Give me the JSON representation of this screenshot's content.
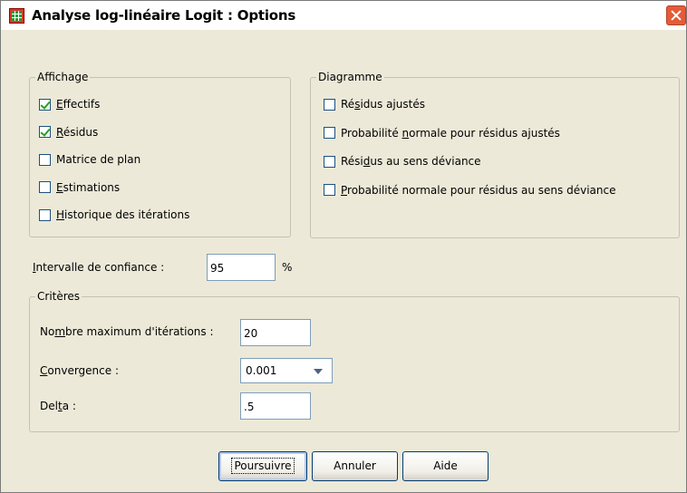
{
  "window": {
    "title": "Analyse log-linéaire Logit : Options"
  },
  "affichage": {
    "legend": "Affichage",
    "items": [
      {
        "pre": "",
        "u": "E",
        "post": "ffectifs",
        "checked": true
      },
      {
        "pre": "",
        "u": "R",
        "post": "ésidus",
        "checked": true
      },
      {
        "pre": "Matrice de plan",
        "u": "",
        "post": "",
        "checked": false
      },
      {
        "pre": "",
        "u": "E",
        "post": "stimations",
        "checked": false
      },
      {
        "pre": "",
        "u": "H",
        "post": "istorique des itérations",
        "checked": false
      }
    ]
  },
  "diagramme": {
    "legend": "Diagramme",
    "items": [
      {
        "pre": "Ré",
        "u": "s",
        "post": "idus ajustés",
        "checked": false
      },
      {
        "pre": "Probabilité ",
        "u": "n",
        "post": "ormale pour résidus ajustés",
        "checked": false
      },
      {
        "pre": "Rési",
        "u": "d",
        "post": "us au sens déviance",
        "checked": false
      },
      {
        "pre": "",
        "u": "P",
        "post": "robabilité normale pour résidus au sens déviance",
        "checked": false
      }
    ]
  },
  "confidence": {
    "pre": "",
    "u": "I",
    "post": "ntervalle de confiance :",
    "value": "95",
    "unit": "%"
  },
  "criteres": {
    "legend": "Critères",
    "max_iter": {
      "pre": "No",
      "u": "m",
      "post": "bre maximum d'itérations :",
      "value": "20"
    },
    "convergence": {
      "pre": "",
      "u": "C",
      "post": "onvergence :",
      "value": "0.001"
    },
    "delta": {
      "pre": "Del",
      "u": "t",
      "post": "a :",
      "value": ".5"
    }
  },
  "buttons": {
    "continue": "Poursuivre",
    "cancel": "Annuler",
    "help": "Aide"
  }
}
